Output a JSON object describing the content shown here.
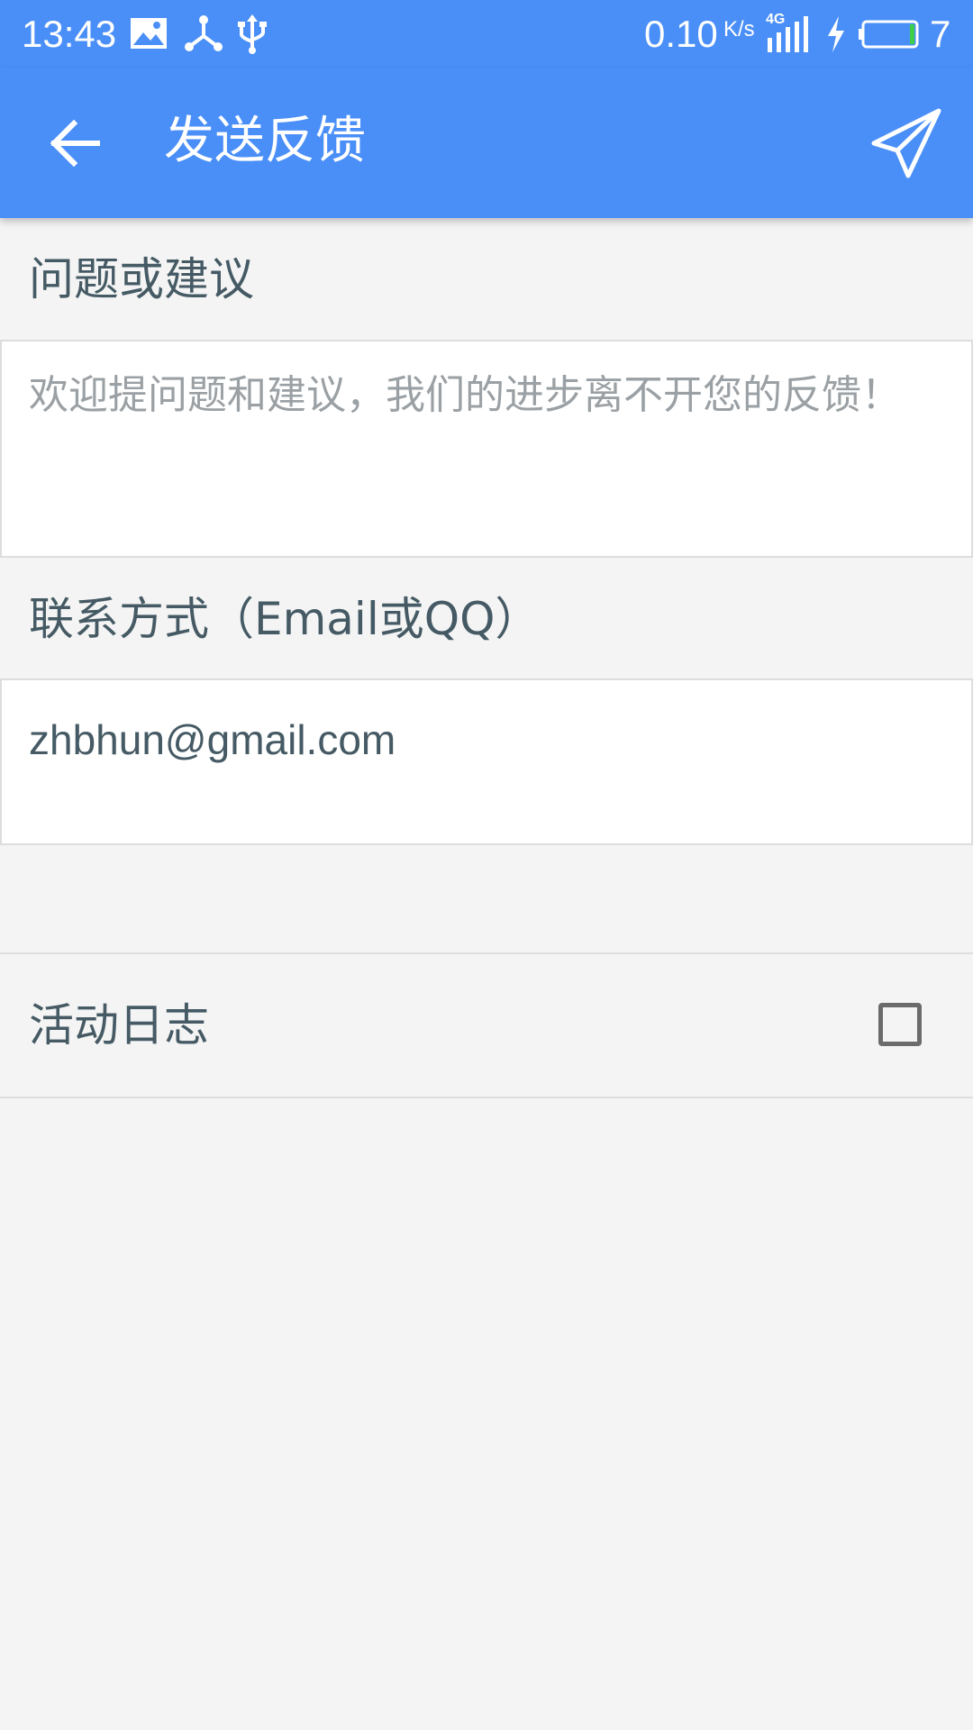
{
  "status_bar": {
    "time": "13:43",
    "network_speed": "0.10",
    "network_unit": "K/s",
    "signal_label": "4G",
    "battery_level": "7",
    "icons": [
      "image-icon",
      "share-hub-icon",
      "usb-icon",
      "signal-4g-icon",
      "charging-icon",
      "battery-icon"
    ]
  },
  "app_bar": {
    "title": "发送反馈",
    "back_icon": "arrow-left-icon",
    "send_icon": "paper-plane-icon",
    "color": "#4a8ff7"
  },
  "form": {
    "feedback_label": "问题或建议",
    "feedback_placeholder": "欢迎提问题和建议，我们的进步离不开您的反馈！",
    "contact_label": "联系方式（Email或QQ）",
    "contact_value": "zhbhun@gmail.com",
    "activity_log_label": "活动日志",
    "activity_log_checked": false
  }
}
